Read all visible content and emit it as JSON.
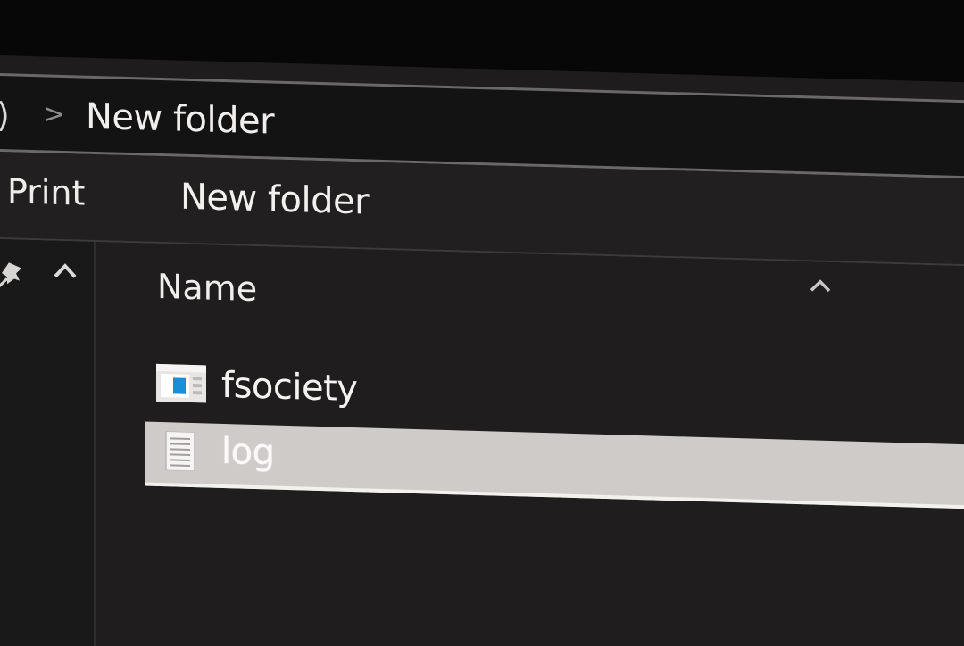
{
  "address_bar": {
    "truncated_crumb": ")",
    "separator": ">",
    "current_folder": "New folder"
  },
  "toolbar": {
    "print_label": "Print",
    "new_folder_label": "New folder"
  },
  "nav_pane": {
    "pin_icon": "pin-icon",
    "collapse_icon": "chevron-up-icon"
  },
  "file_list": {
    "column_header": "Name",
    "sort_icon": "chevron-up-icon",
    "files": [
      {
        "name": "fsociety",
        "icon": "window-file-icon",
        "selected": false
      },
      {
        "name": "log",
        "icon": "text-document-icon",
        "selected": true
      }
    ]
  },
  "colors": {
    "background": "#1f1d1d",
    "selection": "#cfcbc8",
    "accent_icon": "#1a8fd8"
  }
}
